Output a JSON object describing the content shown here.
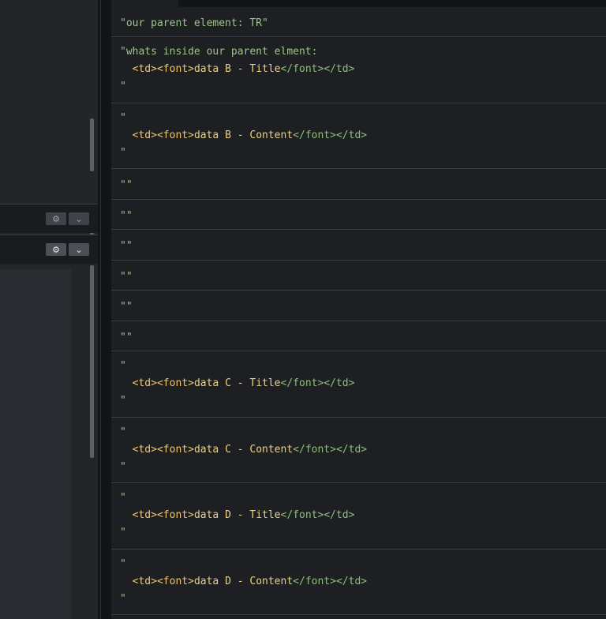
{
  "left_panel": {
    "toolbar_rows": [
      {
        "gear_icon": "gear-icon",
        "chevron_icon": "chevron-down-icon"
      },
      {
        "gear_icon": "gear-icon",
        "chevron_icon": "chevron-down-icon"
      }
    ]
  },
  "log": {
    "entries": [
      {
        "lines": [
          "\"our parent element: TR\""
        ]
      },
      {
        "lines": [
          "\"whats inside our parent elment:",
          "  <td><font>data B - Title</font></td>",
          "\""
        ]
      },
      {
        "lines": [
          "\"",
          "  <td><font>data B - Content</font></td>",
          "\""
        ]
      },
      {
        "lines": [
          "\"\""
        ]
      },
      {
        "lines": [
          "\"\""
        ]
      },
      {
        "lines": [
          "\"\""
        ]
      },
      {
        "lines": [
          "\"\""
        ]
      },
      {
        "lines": [
          "\"\""
        ]
      },
      {
        "lines": [
          "\"\""
        ]
      },
      {
        "lines": [
          "\"",
          "  <td><font>data C - Title</font></td>",
          "\""
        ]
      },
      {
        "lines": [
          "\"",
          "  <td><font>data C - Content</font></td>",
          "\""
        ]
      },
      {
        "lines": [
          "\"",
          "  <td><font>data D - Title</font></td>",
          "\""
        ]
      },
      {
        "lines": [
          "\"",
          "  <td><font>data D - Content</font></td>",
          "\""
        ]
      }
    ]
  },
  "colors": {
    "background": "#1e1f23",
    "string": "#8fbf7d",
    "tag": "#f0c674",
    "separator": "#3d3f45"
  }
}
